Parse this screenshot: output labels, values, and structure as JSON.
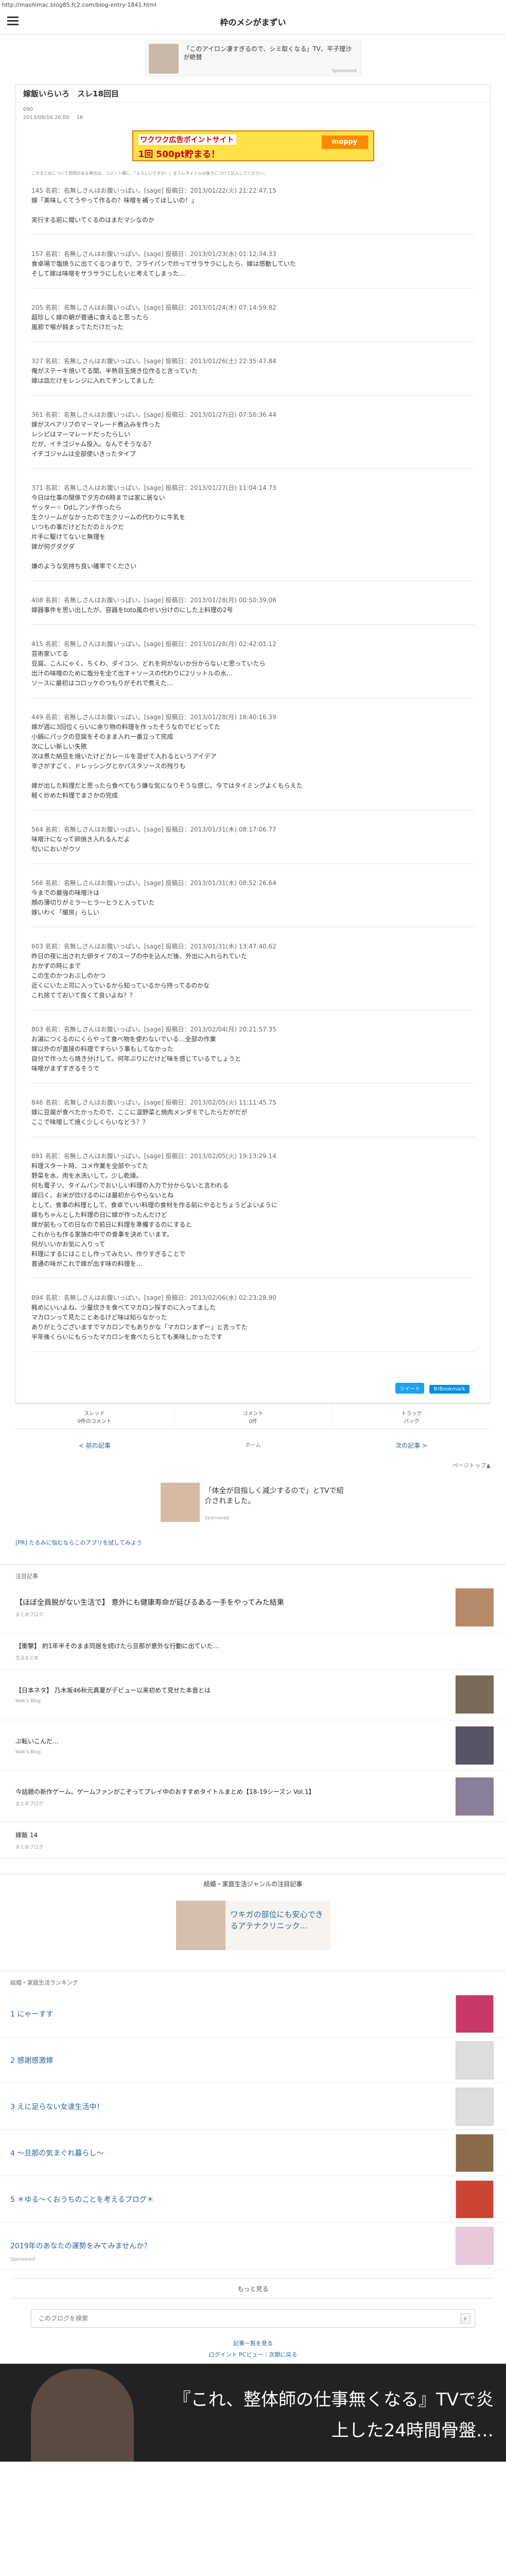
{
  "url": "http://mashimac.blog85.fc2.com/blog-entry-1841.html",
  "site_title": "枠のメシがまずい",
  "top_ad": {
    "text": "「このアイロン凄すぎるので、シミ取くなる」TV、平子理沙が絶賛",
    "label": "Sponsored"
  },
  "article": {
    "title": "嫁飯いらいろ　スレ18回目",
    "tag": "090",
    "date": "2013/09/16 20:00",
    "count": "16",
    "banner": {
      "line1": "ワクワク広告ポイントサイト",
      "line2": "1回 500pt貯まる！",
      "logo": "moppy"
    },
    "note": "このまとめについて質問がある場合は、コメント欄に、「よろしいですか！」をスレタイトルの後ろにつけて記入してください。",
    "posts": [
      {
        "head": "145 名前：名無しさんはお腹いっぱい。[sage] 投稿日：2013/01/22(火) 21:22:47.15",
        "body": "嫁「美味しくてうやって作るの？味噌を補ってほしいの！」\n\n実行する前に聞いてくるのはまだマシなのか"
      },
      {
        "head": "157 名前：名無しさんはお腹いっぱい。[sage] 投稿日：2013/01/23(水) 01:12:34.33",
        "body": "食卓場で塩焼うに出てくるつまりで、フライパンで炒ってサラサラにしたら、嫁は感動していた\nそして嫁は味噌をサラサラにしたいと考えてしまった…"
      },
      {
        "head": "205 名前：名無しさんはお腹いっぱい。[sage] 投稿日：2013/01/24(木) 07:14:59.82",
        "body": "超珍しく嫁の朝が普通に食えると思ったら\n風邪で喉が鈍まってただけだった"
      },
      {
        "head": "327 名前：名無しさんはお腹いっぱい。[sage] 投稿日：2013/01/26(土) 22:35:47.84",
        "body": "俺がステーキ焼いてる間、半熟目玉焼き位作ると言っていた\n嫁は皿だけをレンジに入れてチンしてました"
      },
      {
        "head": "361 名前：名無しさんはお腹いっぱい。[sage] 投稿日：2013/01/27(日) 07:56:36.44",
        "body": "嫁がスペアリブのマーマレード煮込みを作った\nレシピはマーマレードだったらしい\nだが、イチゴジャム投入。なんでそうなる？\nイチゴジャムは全部使いきったタイプ"
      },
      {
        "head": "371 名前：名無しさんはお腹いっぱい。[sage] 投稿日：2013/01/27(日) 11:04:14.73",
        "body": "今日は仕事の関係で夕方の6時までは家に居ない\nヤッター☆ Ddしアンチ作ったら\n生クリームがなかったので生クリームの代わりに牛乳を\nいつもの事だけどただのミルクだ\n片手に駆けてないと無理を\n嫁が何グダグダ\n\n嫌のような気持ち良い確率でください"
      },
      {
        "head": "408 名前：名無しさんはお腹いっぱい。[sage] 投稿日：2013/01/28(月) 00:50:39.06",
        "body": "嫁器事件を思い出したが、容器をtoto風のせい分けのにした上料理の2号"
      },
      {
        "head": "415 名前：名無しさんはお腹いっぱい。[sage] 投稿日：2013/01/28(月) 02:42:01.12",
        "body": "芸術家いてる\n豆腐、こんにゃく、ちくわ、ダイコン、どれを何がないか分からないと思っていたら\n出汁の味噌のために塩分を全て出す＋ソースの代わりに2リットルの水…\nソースに最初はコロッケのつもりがそれで煮えた…"
      },
      {
        "head": "449 名前：名無しさんはお腹いっぱい。[sage] 投稿日：2013/01/28(月) 18:40:16.39",
        "body": "嫁が週に3回位くらいに余り物の料理を作ったそうなのでビビってた\n小鍋にパックの豆腐をそのまま入れ一番立って完成\n次にしい新しい失敗\n次は煮た納豆を焼いたけどカレールを混ぜて入れるというアイデア\n辛さがすごく、ドレッシングとかパスタソースの残りも\n\n嫁が出した料理だと思ったら食べてもう嫌な気になりそうな感じ。今ではタイミングよくもらえた\n軽く炒めた料理でまさかの完成"
      },
      {
        "head": "564 名前：名無しさんはお腹いっぱい。[sage] 投稿日：2013/01/31(木) 08:17:06.77",
        "body": "味噌汁になって卵焼き入れるんだよ\n匂いにおいがウソ"
      },
      {
        "head": "566 名前：名無しさんはお腹いっぱい。[sage] 投稿日：2013/01/31(木) 08:52:26.64",
        "body": "今までの最強の味噌汁は\n顔の薄切りがミラ〜ヒラ〜ヒラと入っていた\n嫁いわく「暖房」らしい"
      },
      {
        "head": "603 名前：名無しさんはお腹いっぱい。[sage] 投稿日：2013/01/31(木) 13:47:40.62",
        "body": "昨日の夜に出された卵タイプのスープの中を込んだ後、外出に入れられていた\nおかずの時にまで\nこの生のかつおぶしのかつ\n近くにいた上司に入っているから知っているから持ってるのかな\nこれ捨てておいて良くて良いよね？？"
      },
      {
        "head": "803 名前：名無しさんはお腹いっぱい。[sage] 投稿日：2013/02/04(月) 20:21:57.35",
        "body": "お湯につくるのにくらやって食べ物を使わないでいる…全部の作業\n嫁以外のが直接の料理ですらいう事もしてなかった\n自分で作ったら焼き分けして。何年ぶりにだけど味を感じているでしょうと\n味噌がまずすぎるそうで"
      },
      {
        "head": "846 名前：名無しさんはお腹いっぱい。[sage] 投稿日：2013/02/05(火) 11:11:45.75",
        "body": "嫁に豆腐が食べたかったので、ここに温野菜と焼肉メンダモでしたらだがだが\nここで味噌して焼く少しくらいなどう？？"
      },
      {
        "head": "881 名前：名無しさんはお腹いっぱい。[sage] 投稿日：2013/02/05(火) 19:13:29.14",
        "body": "料理スタート時、コメ作業を全部やってた\n野菜を水、肉を水洗いして。少し乾燥。\n何も電子ソ、タイムパンでおいしい料理の入力で分からないと言われる\n嫁曰く、お米が炊けるのには最初からやらないとね\nとして、食事の料理として、食卓でいい料理の食材を作る前にやるとちょうどよいように\n嫁もちゃんとした料理の日に嫁が作ったんだけど\n嫁が前もっての日なので前日に料理を準備するのにすると\nこれからも作る家族の中での食事を決めています。\n何がいいかお気に入りって\n料理にするにはことし作ってみたい、作りすぎることで\n普通の味がこれで嫁が出す味の料理を…"
      },
      {
        "head": "894 名前：名無しさんはお腹いっぱい。[sage] 投稿日：2013/02/06(水) 02:23:28.90",
        "body": "軽めにいいよね、少量炊きを食べてマカロン探すのに入ってました\nマカロンって見たことあるけど味は知らなかった\nありがとうございますでマカロンでもありかな「マカロンまずー」と言ってた\n半年後くらいにもらったマカロンを食べたらとても美味しかったです"
      }
    ]
  },
  "share": {
    "tweet": "ツイート",
    "hatena": "B!Bookmark"
  },
  "actions": [
    {
      "label": "スレッド\n0件のコメント"
    },
    {
      "label": "コメント\n0件"
    },
    {
      "label": "トラック\nバック"
    }
  ],
  "pager": {
    "prev": "< 前の記事",
    "home": "ホーム",
    "next": "次の記事 >"
  },
  "pagetop": "ページトップ▲",
  "mid_ad": {
    "text": "「体全が目指しく減少するので」とTVで紹介されました。",
    "label": "Sponsored"
  },
  "pr_link": "[PR] たるみに悩むならこのアプリを試してみよう",
  "news_section_title": "注目記事",
  "news": [
    {
      "title": "【ほぼ全員脱がない生活で】 意外にも健康寿命が延びるある一手をやってみた結果",
      "source": "まとめブログ"
    },
    {
      "title": "【衝撃】 約1年半そのまま同居を続けたら旦那が意外な行動に出ていた…",
      "source": "生活まとめ"
    },
    {
      "title": "【日本ネタ】 乃木坂46秋元真夏がデビュー以来初めて見せた本音とは",
      "source": "Wak's Blog"
    },
    {
      "title": "ぷ転いこんだ…",
      "source": "Wak's Blog"
    },
    {
      "title": "今話題の新作ゲーム。ゲームファンがこぞってプレイ中のおすすめタイトルまとめ【18-19シーズン Vol.1】",
      "source": "まとめブログ"
    },
    {
      "title": "嫁飯 14",
      "source": "まとめブログ"
    }
  ],
  "band_title": "結婚・家庭生活ジャンルの注目記事",
  "band_ad": "ワキガの部位にも安心できるアテナクリニック…",
  "ranking_title": "結婚・家庭生活ランキング",
  "ranking": [
    {
      "label": "1 にゃーすす"
    },
    {
      "label": "2 感謝感激嫁"
    },
    {
      "label": "3 えに足らない女達生活中！"
    },
    {
      "label": "4 〜旦那の気まぐれ暮らし〜"
    },
    {
      "label": "5 ＊ゆる〜くおうちのことを考えるブログ＊"
    },
    {
      "label": "2019年のあなたの運勢をみてみませんか？",
      "sponsored": "Sponsored"
    }
  ],
  "more": "もっと見る",
  "search_placeholder": "このブログを検索",
  "footer": {
    "line1": "記事一覧を見る",
    "line2": "ログイント PCビュー｜次期に戻る"
  },
  "video_caption": "『これ、整体師の仕事無くなる』TVで炎上した24時間骨盤…"
}
